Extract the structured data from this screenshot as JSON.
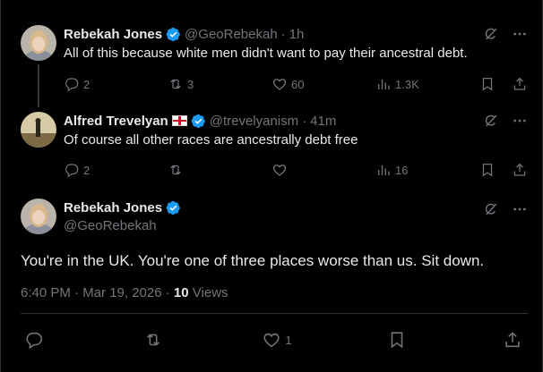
{
  "thread": [
    {
      "name": "Rebekah Jones",
      "handle": "@GeoRebekah",
      "time": "1h",
      "text": "All of this because white men didn't want to pay their ancestral debt.",
      "stats": {
        "replies": "2",
        "reposts": "3",
        "likes": "60",
        "views": "1.3K"
      }
    },
    {
      "name": "Alfred Trevelyan",
      "handle": "@trevelyanism",
      "time": "41m",
      "text": "Of course all other races are ancestrally debt free",
      "stats": {
        "replies": "2",
        "reposts": "",
        "likes": "",
        "views": "16"
      }
    }
  ],
  "focal": {
    "name": "Rebekah Jones",
    "handle": "@GeoRebekah",
    "text": "You're in the UK. You're one of three places worse than us. Sit down.",
    "timestamp": "6:40 PM · Mar 19, 2026 · ",
    "views_count": "10",
    "views_label": "Views",
    "stats": {
      "replies": "",
      "reposts": "",
      "likes": "1"
    }
  },
  "separator": "·",
  "icons": {
    "verified": "verified-badge-icon",
    "grok": "grok-icon",
    "more": "more-icon",
    "reply": "reply-icon",
    "repost": "repost-icon",
    "like": "heart-icon",
    "views": "analytics-icon",
    "bookmark": "bookmark-icon",
    "share": "share-icon",
    "flag": "england-flag-icon"
  },
  "colors": {
    "background": "#000000",
    "text": "#e7e9ea",
    "muted": "#71767b",
    "verified": "#1d9bf0",
    "border": "#2f3336"
  }
}
